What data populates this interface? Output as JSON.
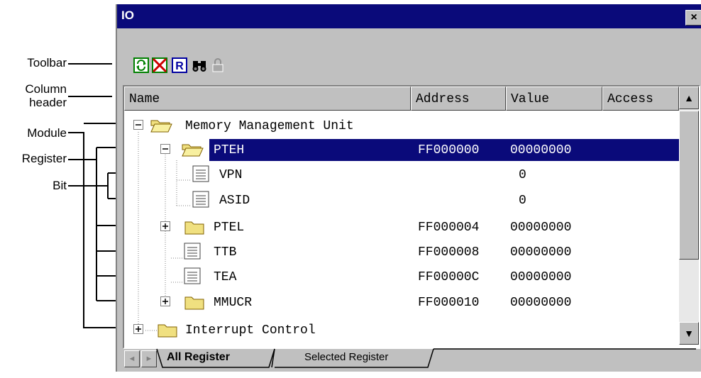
{
  "callouts": [
    {
      "label": "Toolbar"
    },
    {
      "label": "Column\nheader"
    },
    {
      "label": "Module"
    },
    {
      "label": "Register"
    },
    {
      "label": "Bit"
    }
  ],
  "window": {
    "title": "IO",
    "close_label": "×"
  },
  "toolbar": {
    "buttons": [
      {
        "name": "refresh",
        "icon": "refresh-icon"
      },
      {
        "name": "disable-refresh",
        "icon": "crossed-out-icon"
      },
      {
        "name": "register",
        "icon": "register-R-icon"
      },
      {
        "name": "find",
        "icon": "binoculars-icon"
      },
      {
        "name": "lock",
        "icon": "lock-icon",
        "disabled": true
      }
    ]
  },
  "columns": {
    "name": "Name",
    "address": "Address",
    "value": "Value",
    "access": "Access"
  },
  "rows": [
    {
      "label": "Memory Management Unit",
      "address": "",
      "value": "",
      "expander": "−",
      "icon": "open-folder-icon"
    },
    {
      "label": "PTEH",
      "address": "FF000000",
      "value": "00000000",
      "expander": "−",
      "icon": "open-folder-icon",
      "selected": true
    },
    {
      "label": "VPN",
      "address": "",
      "value": "0",
      "icon": "document-icon"
    },
    {
      "label": "ASID",
      "address": "",
      "value": "0",
      "icon": "document-icon"
    },
    {
      "label": "PTEL",
      "address": "FF000004",
      "value": "00000000",
      "expander": "+",
      "icon": "folder-icon"
    },
    {
      "label": "TTB",
      "address": "FF000008",
      "value": "00000000",
      "icon": "document-icon"
    },
    {
      "label": "TEA",
      "address": "FF00000C",
      "value": "00000000",
      "icon": "document-icon"
    },
    {
      "label": "MMUCR",
      "address": "FF000010",
      "value": "00000000",
      "expander": "+",
      "icon": "folder-icon"
    },
    {
      "label": "Interrupt Control",
      "address": "",
      "value": "",
      "expander": "+",
      "icon": "folder-icon"
    }
  ],
  "scrollbar": {
    "up": "▲",
    "down": "▼"
  },
  "tabs": {
    "all": "All Register",
    "selected": "Selected Register",
    "prev": "◄",
    "next": "►"
  },
  "colors": {
    "titlebar": "#0a0a7a",
    "selection": "#0a0a7a",
    "window_bg": "#c0c0c0"
  }
}
